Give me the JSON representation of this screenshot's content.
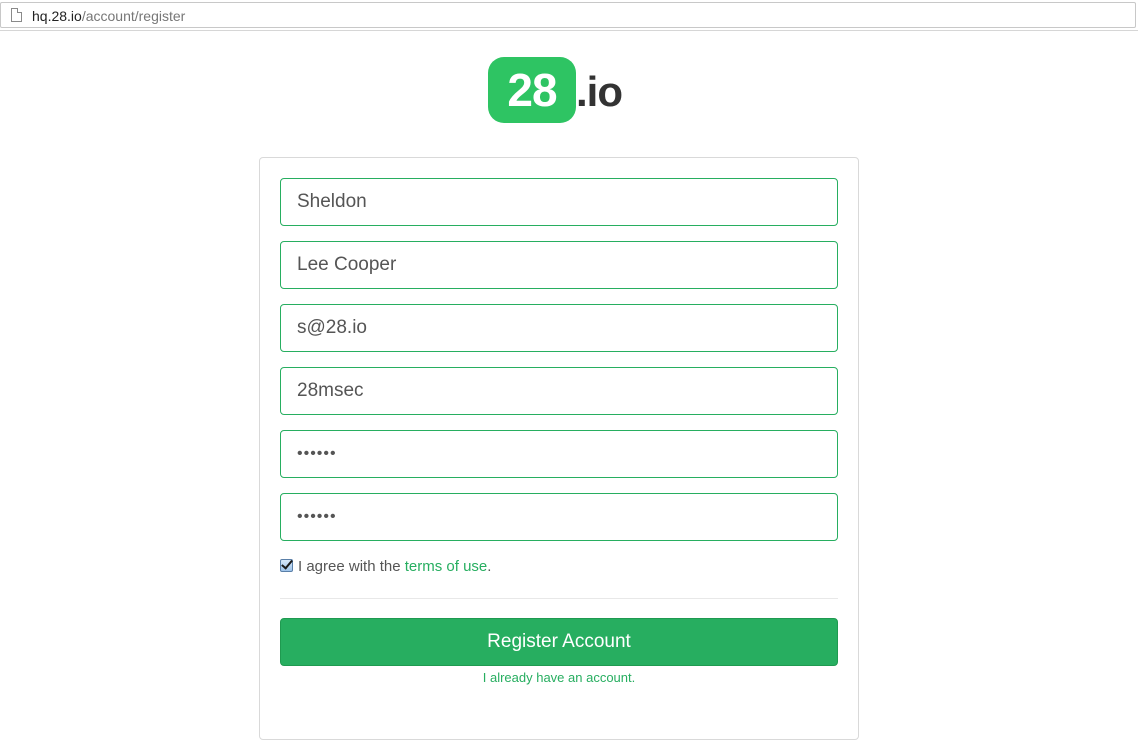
{
  "browser": {
    "url_host": "hq.28.io",
    "url_path": "/account/register"
  },
  "logo": {
    "badge_text": "28",
    "suffix_text": ".io"
  },
  "form": {
    "first_name": "Sheldon",
    "last_name": "Lee Cooper",
    "email": "s@28.io",
    "company": "28msec",
    "password_mask": "••••••",
    "confirm_password_mask": "••••••",
    "agree_prefix": "I agree with the ",
    "terms_link": "terms of use",
    "agree_suffix": ".",
    "agree_checked": true,
    "submit_label": "Register Account",
    "login_link": "I already have an account."
  },
  "colors": {
    "accent": "#27ae60",
    "logo_green": "#2ec463",
    "logo_text": "#333333"
  }
}
